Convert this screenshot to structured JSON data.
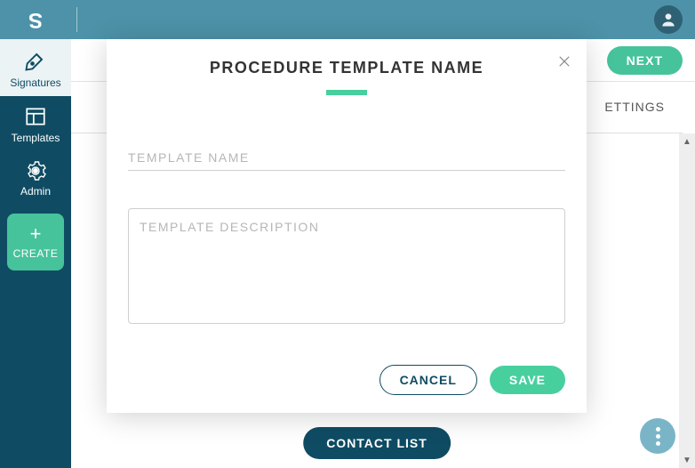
{
  "sidebar": {
    "items": [
      {
        "label": "Signatures"
      },
      {
        "label": "Templates"
      },
      {
        "label": "Admin"
      }
    ],
    "create_label": "CREATE"
  },
  "actionbar": {
    "next_label": "NEXT"
  },
  "secondary_tab_partial": "ETTINGS",
  "contact_list_label": "CONTACT LIST",
  "modal": {
    "title": "PROCEDURE TEMPLATE NAME",
    "name_placeholder": "TEMPLATE NAME",
    "description_placeholder": "TEMPLATE DESCRIPTION",
    "cancel_label": "CANCEL",
    "save_label": "SAVE"
  }
}
